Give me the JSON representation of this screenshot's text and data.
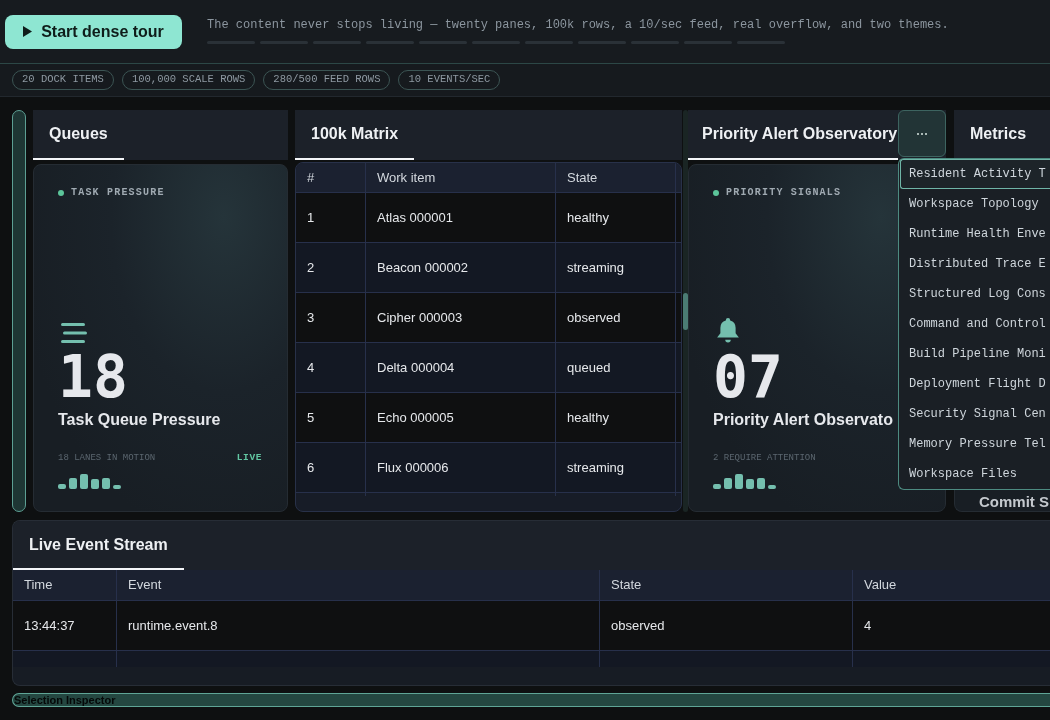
{
  "header": {
    "tour_button": "Start dense tour",
    "tagline": "The content never stops living — twenty panes, 100k rows, a 10/sec feed, real overflow, and two themes.",
    "tour_steps": [
      {
        "active": false
      },
      {
        "active": false
      },
      {
        "active": false
      },
      {
        "active": false
      },
      {
        "active": false
      },
      {
        "active": false
      },
      {
        "active": false
      },
      {
        "active": false
      },
      {
        "active": false
      },
      {
        "active": false
      },
      {
        "active": false
      }
    ]
  },
  "chips": [
    "20 DOCK ITEMS",
    "100,000 SCALE ROWS",
    "280/500 FEED ROWS",
    "10 EVENTS/SEC"
  ],
  "panels": [
    {
      "kind": "queues",
      "tab": {
        "label": "Queues",
        "selected": true
      },
      "card": {
        "eyebrow": "TASK PRESSURE",
        "value": "18",
        "title": "Task Queue Pressure",
        "footnote": "18 LANES IN MOTION",
        "badge": "LIVE"
      }
    },
    {
      "kind": "matrix",
      "tab": {
        "label": "100k Matrix",
        "selected": true
      },
      "table": {
        "columns": [
          "#",
          "Work item",
          "State"
        ],
        "rows": [
          [
            "1",
            "Atlas 000001",
            "healthy"
          ],
          [
            "2",
            "Beacon 000002",
            "streaming"
          ],
          [
            "3",
            "Cipher 000003",
            "observed"
          ],
          [
            "4",
            "Delta 000004",
            "queued"
          ],
          [
            "5",
            "Echo 000005",
            "healthy"
          ],
          [
            "6",
            "Flux 000006",
            "streaming"
          ]
        ]
      }
    },
    {
      "kind": "alerts",
      "tab": {
        "label": "Priority Alert Observatory",
        "selected": true
      },
      "card": {
        "eyebrow": "PRIORITY SIGNALS",
        "value": "07",
        "title": "Priority Alert Observato",
        "footnote": "2 REQUIRE ATTENTION"
      },
      "menu": {
        "open": true,
        "items": [
          {
            "label": "Resident Activity T",
            "selected": true
          },
          {
            "label": "Workspace Topology",
            "selected": false
          },
          {
            "label": "Runtime Health Enve",
            "selected": false
          },
          {
            "label": "Distributed Trace E",
            "selected": false
          },
          {
            "label": "Structured Log Cons",
            "selected": false
          },
          {
            "label": "Command and Control",
            "selected": false
          },
          {
            "label": "Build Pipeline Moni",
            "selected": false
          },
          {
            "label": "Deployment Flight D",
            "selected": false
          },
          {
            "label": "Security Signal Cen",
            "selected": false
          },
          {
            "label": "Memory Pressure Tel",
            "selected": false
          },
          {
            "label": "Workspace Files",
            "selected": false
          }
        ]
      }
    },
    {
      "kind": "metrics",
      "tab": {
        "label": "Metrics"
      },
      "card": {
        "title": "Commit S"
      }
    }
  ],
  "event_stream": {
    "tab": {
      "label": "Live Event Stream",
      "selected": true
    },
    "table": {
      "columns": [
        "Time",
        "Event",
        "State",
        "Value"
      ],
      "rows": [
        [
          "13:44:37",
          "runtime.event.8",
          "observed",
          "4"
        ]
      ]
    }
  },
  "inspector": {
    "label": "Selection Inspector"
  }
}
